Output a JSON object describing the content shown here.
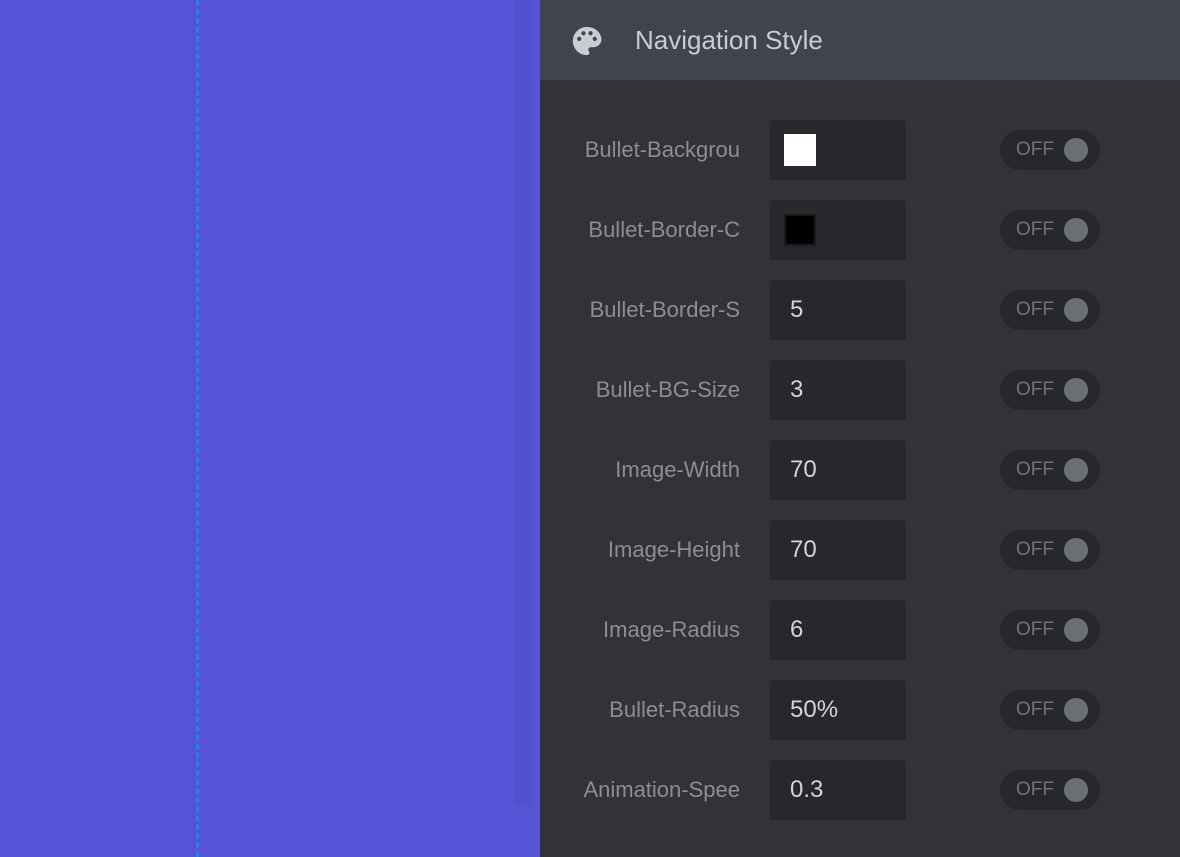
{
  "panel": {
    "title": "Navigation Style",
    "icon": "palette-icon"
  },
  "colors": {
    "canvas_bg": "#5654d4",
    "guide_line": "#2f7cf0",
    "panel_bg": "#323336",
    "header_bg": "#40454d"
  },
  "rows": [
    {
      "label": "Bullet-Backgrou",
      "type": "color",
      "value": "#ffffff",
      "toggle": "OFF"
    },
    {
      "label": "Bullet-Border-C",
      "type": "color",
      "value": "#000000",
      "toggle": "OFF"
    },
    {
      "label": "Bullet-Border-S",
      "type": "text",
      "value": "5",
      "toggle": "OFF"
    },
    {
      "label": "Bullet-BG-Size",
      "type": "text",
      "value": "3",
      "toggle": "OFF"
    },
    {
      "label": "Image-Width",
      "type": "text",
      "value": "70",
      "toggle": "OFF"
    },
    {
      "label": "Image-Height",
      "type": "text",
      "value": "70",
      "toggle": "OFF"
    },
    {
      "label": "Image-Radius",
      "type": "text",
      "value": "6",
      "toggle": "OFF"
    },
    {
      "label": "Bullet-Radius",
      "type": "text",
      "value": "50%",
      "toggle": "OFF"
    },
    {
      "label": "Animation-Spee",
      "type": "text",
      "value": "0.3",
      "toggle": "OFF"
    }
  ]
}
